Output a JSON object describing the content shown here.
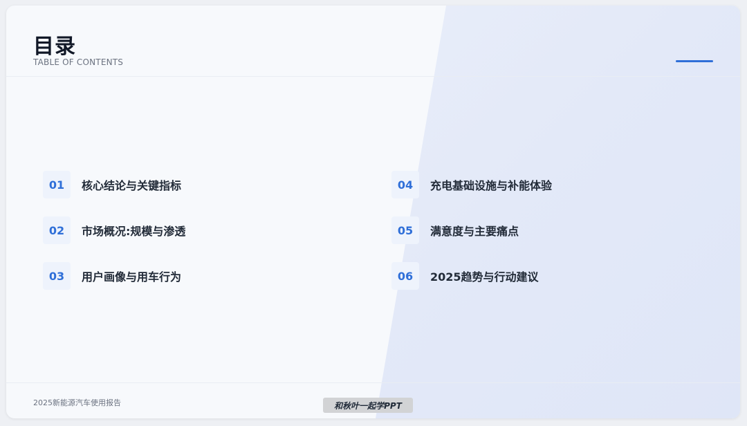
{
  "header": {
    "title": "目录",
    "subtitle": "TABLE OF CONTENTS"
  },
  "toc": [
    {
      "num": "01",
      "label": "核心结论与关键指标"
    },
    {
      "num": "02",
      "label": "市场概况:规模与渗透"
    },
    {
      "num": "03",
      "label": "用户画像与用车行为"
    },
    {
      "num": "04",
      "label": "充电基础设施与补能体验"
    },
    {
      "num": "05",
      "label": "满意度与主要痛点"
    },
    {
      "num": "06",
      "label": "2025趋势与行动建议"
    }
  ],
  "footer": {
    "report_name": "2025新能源汽车使用报告"
  },
  "watermark": "和秋叶一起学PPT",
  "colors": {
    "accent": "#2f6fd8",
    "title": "#111827",
    "muted": "#6b7280"
  }
}
